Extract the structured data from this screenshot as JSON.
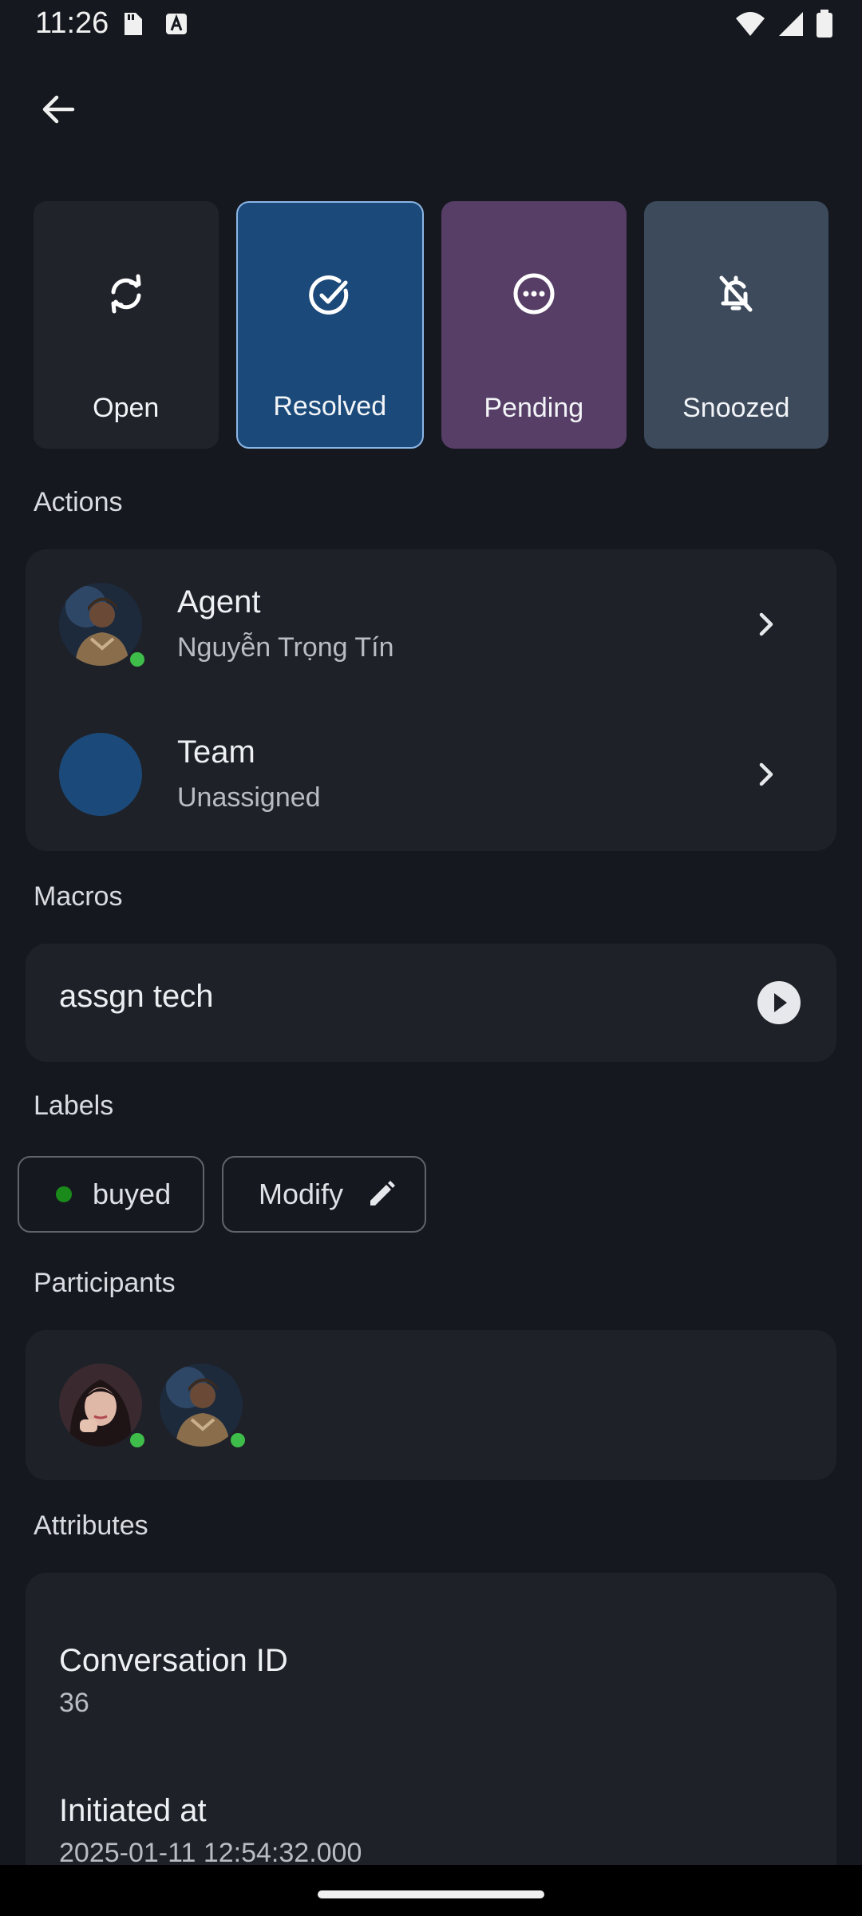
{
  "status_bar": {
    "time": "11:26",
    "left_icons": [
      "sd-card-icon",
      "text-a-icon"
    ],
    "right_icons": [
      "wifi-icon",
      "signal-icon",
      "battery-icon"
    ]
  },
  "header": {
    "back_icon": "arrow-left-icon"
  },
  "statuses": [
    {
      "label": "Open",
      "icon": "refresh-icon",
      "color": "#20232a",
      "selected": false
    },
    {
      "label": "Resolved",
      "icon": "check-circle-icon",
      "color": "#1b4a7a",
      "selected": true
    },
    {
      "label": "Pending",
      "icon": "more-circle-icon",
      "color": "#563e66",
      "selected": false
    },
    {
      "label": "Snoozed",
      "icon": "bell-off-icon",
      "color": "#3c4a5c",
      "selected": false
    }
  ],
  "actions": {
    "heading": "Actions",
    "agent": {
      "title": "Agent",
      "value": "Nguyễn Trọng Tín"
    },
    "team": {
      "title": "Team",
      "value": "Unassigned"
    }
  },
  "macros": {
    "heading": "Macros",
    "items": [
      {
        "name": "assgn tech"
      }
    ]
  },
  "labels": {
    "heading": "Labels",
    "items": [
      {
        "name": "buyed",
        "color": "#1a8a1a"
      }
    ],
    "modify_label": "Modify"
  },
  "participants": {
    "heading": "Participants",
    "count_visible": 2
  },
  "attributes": {
    "heading": "Attributes",
    "items": [
      {
        "title": "Conversation ID",
        "value": "36"
      },
      {
        "title": "Initiated at",
        "value": "2025-01-11 12:54:32.000"
      }
    ]
  },
  "colors": {
    "background": "#15181e",
    "panel": "#1e2128",
    "accent": "#1b4a7a",
    "online": "#3fbd4a"
  }
}
